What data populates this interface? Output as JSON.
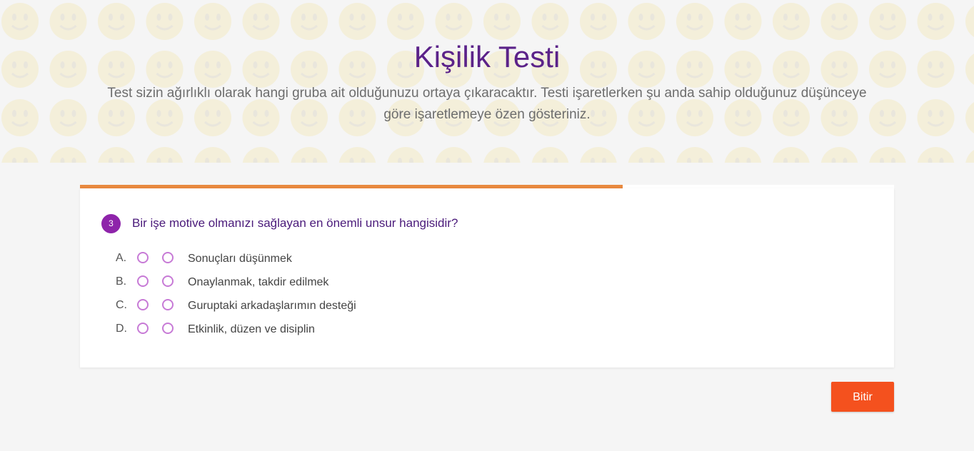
{
  "header": {
    "title": "Kişilik Testi",
    "subtitle": "Test sizin ağırlıklı olarak hangi gruba ait olduğunuzu ortaya çıkaracaktır. Testi işaretlerken şu anda sahip olduğunuz düşünceye göre işaretlemeye özen gösteriniz."
  },
  "progress": {
    "fraction": 0.667,
    "color": "#e8893f"
  },
  "question": {
    "number": "3",
    "text": "Bir işe motive olmanızı sağlayan en önemli unsur hangisidir?",
    "options": [
      {
        "letter": "A.",
        "text": "Sonuçları düşünmek"
      },
      {
        "letter": "B.",
        "text": "Onaylanmak, takdir edilmek"
      },
      {
        "letter": "C.",
        "text": "Guruptaki arkadaşlarımın desteği"
      },
      {
        "letter": "D.",
        "text": "Etkinlik, düzen ve disiplin"
      }
    ]
  },
  "actions": {
    "finish_label": "Bitir"
  },
  "colors": {
    "title": "#5b2289",
    "accent_button": "#f4511e",
    "question_badge": "#8e24aa",
    "radio_border": "#c77ad6"
  }
}
